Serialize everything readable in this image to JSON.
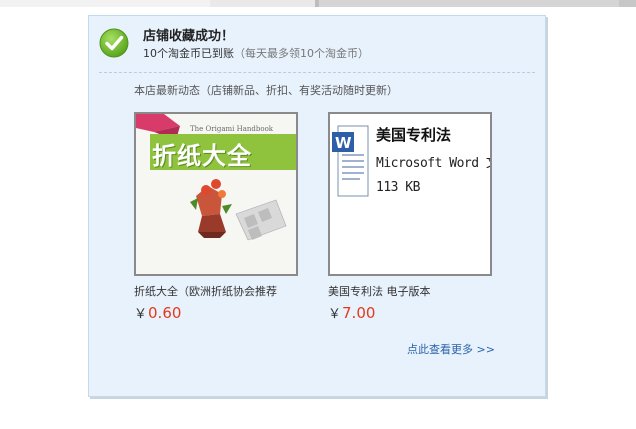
{
  "notice": {
    "title": "店铺收藏成功！",
    "reward_text": "10个淘金币已到账",
    "reward_hint": "（每天最多领10个淘金币）"
  },
  "section_label": "本店最新动态（店铺新品、折扣、有奖活动随时更新）",
  "products": [
    {
      "name": "折纸大全（欧洲折纸协会推荐",
      "currency": "￥",
      "price": "0.60",
      "cover_en": "The Origami Handbook",
      "cover_title": "折纸大全"
    },
    {
      "name": "美国专利法 电子版本",
      "currency": "￥",
      "price": "7.00",
      "doc_title": "美国专利法",
      "doc_type": "Microsoft Word 文档",
      "doc_size": "113 KB"
    }
  ],
  "more_link": "点此查看更多 >>",
  "colors": {
    "panel_bg": "#e8f2fd",
    "check_green": "#7cc23a",
    "price_red": "#e4391b",
    "link_blue": "#2a63a8"
  },
  "icons": {
    "success": "check-circle-icon",
    "word": "word-doc-icon"
  }
}
